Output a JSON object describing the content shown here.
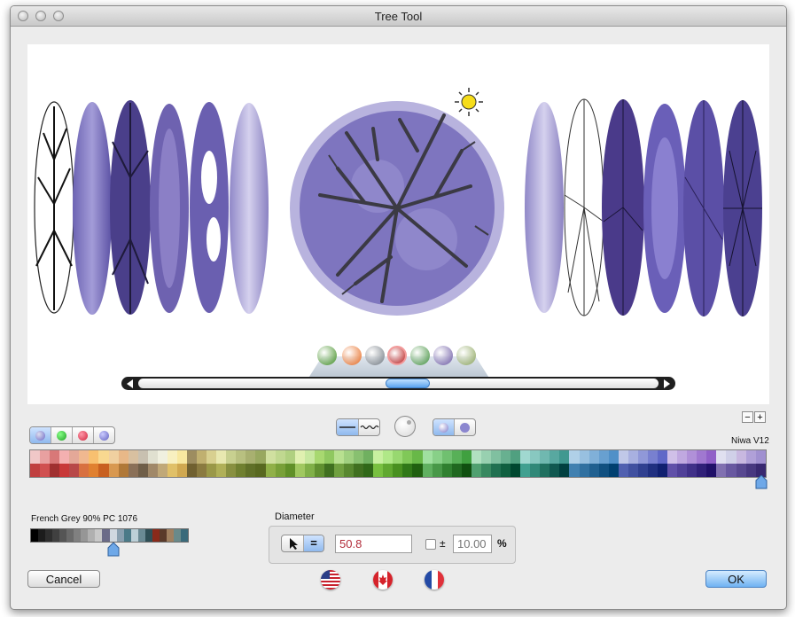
{
  "window": {
    "title": "Tree Tool"
  },
  "preview": {
    "thumbnails": [
      {
        "icon": "spiky-green-tree-icon",
        "color": "#3e8d20"
      },
      {
        "icon": "orange-ball-tree-icon",
        "color": "#e7671b"
      },
      {
        "icon": "grey-branch-tree-icon",
        "color": "#707880"
      },
      {
        "icon": "red-ball-tree-icon",
        "color": "#b91d1d"
      },
      {
        "icon": "green-canopy-tree-icon",
        "color": "#3f8f3a"
      },
      {
        "icon": "purple-canopy-tree-icon",
        "color": "#6a56a2"
      },
      {
        "icon": "olive-canopy-tree-icon",
        "color": "#8aa35a"
      }
    ],
    "scroll_fraction": 0.52
  },
  "palette": {
    "name": "Niwa V12",
    "selected_index": 96,
    "colors": {
      "top": [
        "#f0c8c8",
        "#e8a0a0",
        "#d87878",
        "#f4b0b0",
        "#e4a898",
        "#f0b890",
        "#f8c070",
        "#f8d890",
        "#f0d0a0",
        "#e8b888",
        "#d8c0a0",
        "#c8c0b0",
        "#e0e0d0",
        "#f0f0e0",
        "#f8f0c0",
        "#f8e8a0",
        "#9d8d60",
        "#c0b070",
        "#d8d090",
        "#e8e8b0",
        "#c8d090",
        "#b8c080",
        "#a8b070",
        "#98a860",
        "#d0e0a0",
        "#c0d890",
        "#b0d080",
        "#e0f0b0",
        "#c8e8a0",
        "#a8d870",
        "#90c860",
        "#b8e090",
        "#a0d080",
        "#88c070",
        "#70b060",
        "#c8f0a0",
        "#b0e888",
        "#98d870",
        "#80c858",
        "#68b848",
        "#a0e0a0",
        "#88d088",
        "#70c070",
        "#58b058",
        "#40a040",
        "#b0e0c0",
        "#98d0b0",
        "#80c0a0",
        "#68b090",
        "#50a080",
        "#a0d8d0",
        "#88c8c0",
        "#70b8b0",
        "#58a8a0",
        "#409890",
        "#b0d0e8",
        "#98c0e0",
        "#80b0d8",
        "#68a0d0",
        "#5090c8",
        "#c0c8e8",
        "#a8b0e0",
        "#9098d8",
        "#7880d0",
        "#6068c8",
        "#d0c0e8",
        "#c0a8e0",
        "#b090d8",
        "#a078d0",
        "#9060c8",
        "#e0e0f0",
        "#d0d0e8",
        "#c8b8e0",
        "#b0a0d8",
        "#a090d0"
      ],
      "bottom": [
        "#c04040",
        "#d05050",
        "#a03030",
        "#c83838",
        "#b84848",
        "#d87040",
        "#e08030",
        "#c86020",
        "#d89850",
        "#b07838",
        "#8a7058",
        "#6f5e48",
        "#a08868",
        "#c0a878",
        "#e0c068",
        "#d0a850",
        "#706030",
        "#8a7a40",
        "#9a9848",
        "#b0b058",
        "#889040",
        "#708030",
        "#607028",
        "#586820",
        "#90b048",
        "#78a038",
        "#609028",
        "#a0c860",
        "#80b048",
        "#609030",
        "#407020",
        "#70a040",
        "#588830",
        "#407020",
        "#306818",
        "#78c040",
        "#60a830",
        "#489020",
        "#307818",
        "#206010",
        "#60b060",
        "#489848",
        "#308030",
        "#206820",
        "#105010",
        "#50a070",
        "#388860",
        "#207050",
        "#106040",
        "#004830",
        "#40a090",
        "#308878",
        "#207060",
        "#105850",
        "#004040",
        "#4080b0",
        "#3070a0",
        "#206090",
        "#105080",
        "#004070",
        "#5060b0",
        "#4050a0",
        "#304090",
        "#203080",
        "#102070",
        "#6050a8",
        "#504098",
        "#403088",
        "#302078",
        "#201068",
        "#8070b0",
        "#6858a0",
        "#584890",
        "#483880",
        "#382870"
      ]
    }
  },
  "controls": {
    "plus_label": "+",
    "minus_label": "−",
    "equals_label": "="
  },
  "small_palette": {
    "name": "French Grey 90% PC 1076",
    "colors": [
      "#000000",
      "#1c1c1c",
      "#2e2e2e",
      "#404040",
      "#555555",
      "#6a6a6a",
      "#808080",
      "#969696",
      "#b0b0b0",
      "#c8c8c8",
      "#6b6b88",
      "#d0d8e0",
      "#8aa0b0",
      "#4b7a88",
      "#bcd0d8",
      "#6a8a94",
      "#2f4f56",
      "#8a2a1a",
      "#5a3a2a",
      "#a08060",
      "#6a8a8a",
      "#3a6a7a"
    ],
    "selected_index": 11
  },
  "diameter": {
    "title": "Diameter",
    "value": "50.8",
    "tolerance_symbol": "±",
    "tolerance_placeholder": "10.00",
    "unit": "%"
  },
  "flags": [
    {
      "icon": "us-flag-icon"
    },
    {
      "icon": "canada-flag-icon"
    },
    {
      "icon": "france-flag-icon"
    }
  ],
  "buttons": {
    "cancel": "Cancel",
    "ok": "OK"
  }
}
